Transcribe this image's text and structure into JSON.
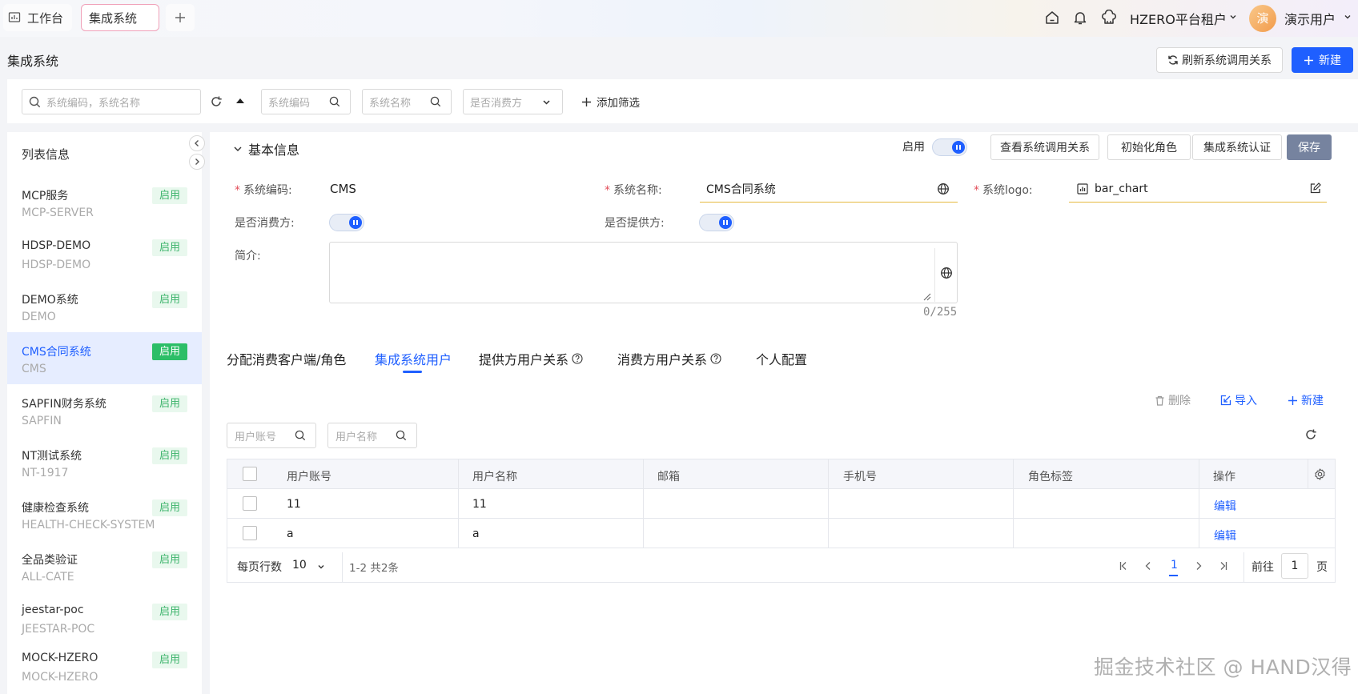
{
  "topbar": {
    "tabs": [
      "工作台",
      "集成系统"
    ],
    "tenant": "HZERO平台租户",
    "avatar_char": "演",
    "user": "演示用户"
  },
  "page": {
    "title": "集成系统",
    "refresh_label": "刷新系统调用关系",
    "new_label": "新建"
  },
  "filters": {
    "search_placeholder": "系统编码，系统名称",
    "code_placeholder": "系统编码",
    "name_placeholder": "系统名称",
    "consumer_placeholder": "是否消费方",
    "add_filter": "添加筛选"
  },
  "sidebar": {
    "title": "列表信息",
    "items": [
      {
        "name": "MCP服务",
        "code": "MCP-SERVER",
        "status": "启用"
      },
      {
        "name": "HDSP-DEMO",
        "code": "HDSP-DEMO",
        "status": "启用"
      },
      {
        "name": "DEMO系统",
        "code": "DEMO",
        "status": "启用"
      },
      {
        "name": "CMS合同系统",
        "code": "CMS",
        "status": "启用"
      },
      {
        "name": "SAPFIN财务系统",
        "code": "SAPFIN",
        "status": "启用"
      },
      {
        "name": "NT测试系统",
        "code": "NT-1917",
        "status": "启用"
      },
      {
        "name": "健康检查系统",
        "code": "HEALTH-CHECK-SYSTEM",
        "status": "启用"
      },
      {
        "name": "全品类验证",
        "code": "ALL-CATE",
        "status": "启用"
      },
      {
        "name": "jeestar-poc",
        "code": "JEESTAR-POC",
        "status": "启用"
      },
      {
        "name": "MOCK-HZERO",
        "code": "MOCK-HZERO",
        "status": "启用"
      }
    ]
  },
  "detail": {
    "section_title": "基本信息",
    "enabled_label": "启用",
    "buttons": {
      "view_relation": "查看系统调用关系",
      "init_role": "初始化角色",
      "auth": "集成系统认证",
      "save": "保存"
    },
    "required_mark": "*",
    "fields": {
      "code_label": "系统编码:",
      "code_value": "CMS",
      "name_label": "系统名称:",
      "name_value": "CMS合同系统",
      "logo_label": "系统logo:",
      "logo_value": "bar_chart",
      "consumer_label": "是否消费方:",
      "provider_label": "是否提供方:",
      "desc_label": "简介:",
      "desc_count": "0/255"
    }
  },
  "tabs": [
    "分配消费客户端/角色",
    "集成系统用户",
    "提供方用户关系",
    "消费方用户关系",
    "个人配置"
  ],
  "table_toolbar": {
    "delete": "删除",
    "import": "导入",
    "new": "新建",
    "account_placeholder": "用户账号",
    "username_placeholder": "用户名称"
  },
  "table": {
    "columns": [
      "用户账号",
      "用户名称",
      "邮箱",
      "手机号",
      "角色标签",
      "操作"
    ],
    "rows": [
      {
        "account": "11",
        "name": "11",
        "email": "",
        "phone": "",
        "role": "",
        "action": "编辑"
      },
      {
        "account": "a",
        "name": "a",
        "email": "",
        "phone": "",
        "role": "",
        "action": "编辑"
      }
    ]
  },
  "pagination": {
    "rows_label": "每页行数",
    "rows_per_page": "10",
    "range": "1-2  共2条",
    "current": "1",
    "goto_label": "前往",
    "goto_value": "1",
    "page_unit": "页"
  },
  "watermark": "掘金技术社区 @ HAND汉得",
  "colors": {
    "primary": "#1f5fff",
    "success": "#2cbe67",
    "required": "#e34d59"
  }
}
